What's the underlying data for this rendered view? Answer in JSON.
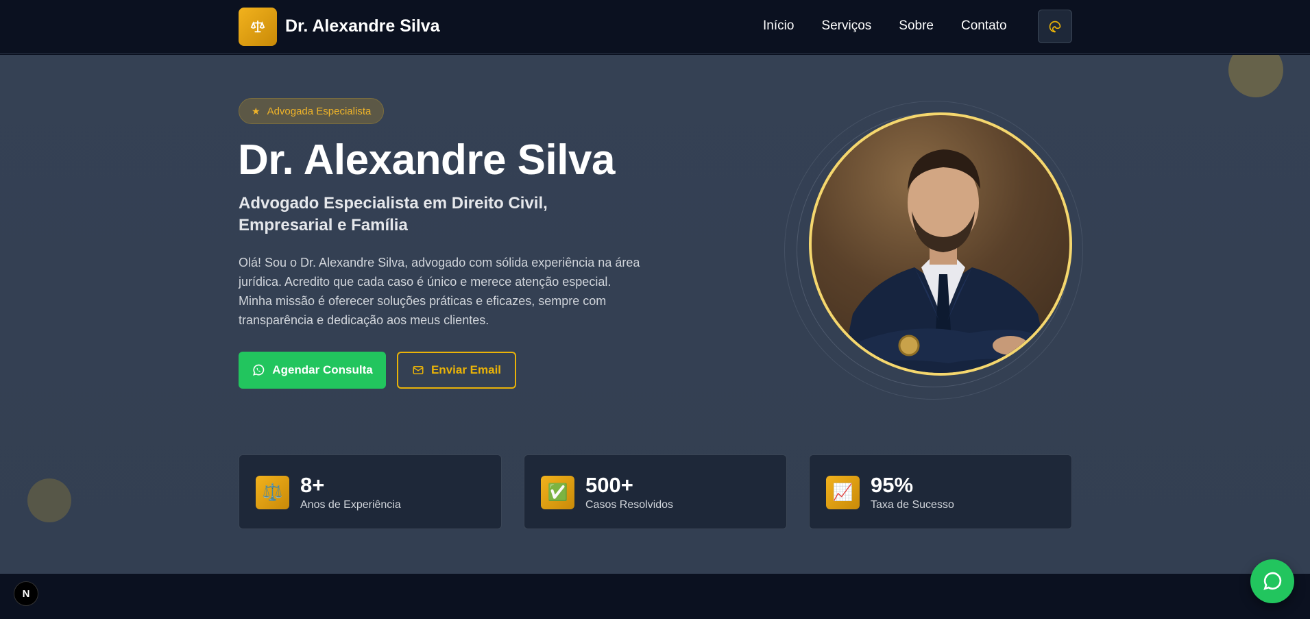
{
  "header": {
    "brand": "Dr. Alexandre Silva",
    "logo_icon": "scales-icon",
    "nav": [
      "Início",
      "Serviços",
      "Sobre",
      "Contato"
    ],
    "theme_toggle_icon": "theme-toggle-icon"
  },
  "hero": {
    "badge": "Advogada Especialista",
    "title": "Dr. Alexandre Silva",
    "subtitle": "Advogado Especialista em Direito Civil, Empresarial e Família",
    "description": "Olá! Sou o Dr. Alexandre Silva, advogado com sólida experiência na área jurídica. Acredito que cada caso é único e merece atenção especial. Minha missão é oferecer soluções práticas e eficazes, sempre com transparência e dedicação aos meus clientes.",
    "primary_button": "Agendar Consulta",
    "secondary_button": "Enviar Email",
    "portrait_icon": "lawyer-portrait"
  },
  "stats": [
    {
      "icon": "⚖️",
      "value": "8+",
      "label": "Anos de Experiência"
    },
    {
      "icon": "✅",
      "value": "500+",
      "label": "Casos Resolvidos"
    },
    {
      "icon": "📈",
      "value": "95%",
      "label": "Taxa de Sucesso"
    }
  ],
  "floating": {
    "next_badge": "N",
    "chat_icon": "chat-bubble-icon"
  },
  "colors": {
    "accent_gold": "#eab308",
    "whatsapp_green": "#22c55e",
    "hero_bg": "#354154",
    "header_bg": "#0b1120"
  }
}
